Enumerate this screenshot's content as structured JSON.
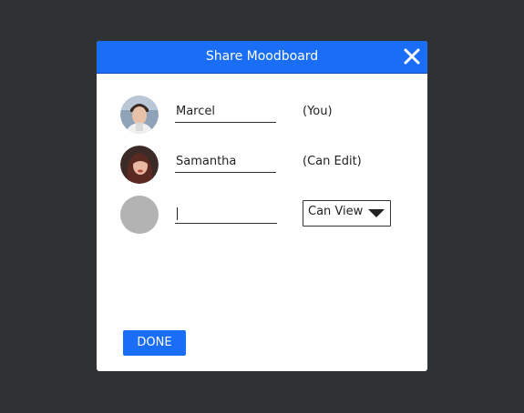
{
  "dialog": {
    "title": "Share Moodboard",
    "done_label": "DONE"
  },
  "users": [
    {
      "name": "Marcel",
      "role": "(You)"
    },
    {
      "name": "Samantha",
      "role": "(Can Edit)"
    }
  ],
  "new_user": {
    "value": "",
    "permission": "Can View"
  },
  "colors": {
    "accent": "#1a6ef5",
    "backdrop": "#2f3235",
    "placeholder_avatar": "#b3b3b3"
  }
}
